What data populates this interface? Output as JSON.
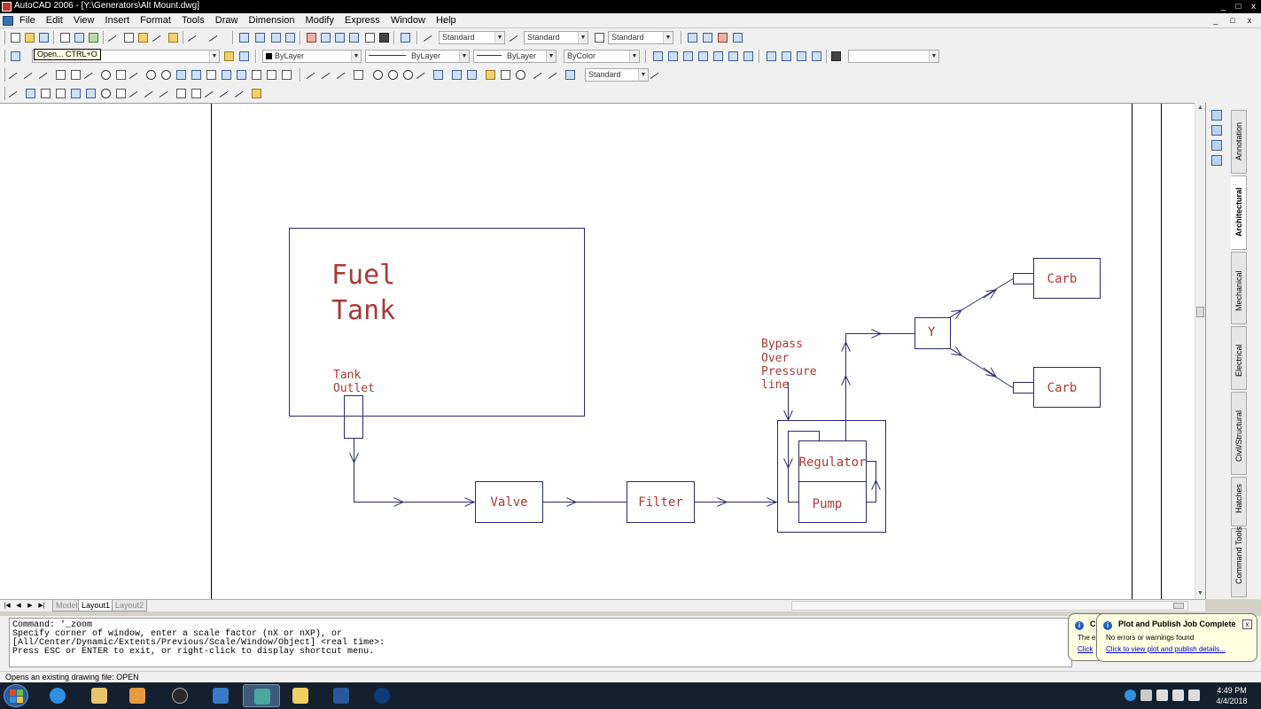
{
  "window": {
    "title": "AutoCAD 2006 - [Y:\\Generators\\Alt Mount.dwg]",
    "buttons": [
      "_",
      "□",
      "x"
    ]
  },
  "menu": {
    "items": [
      "File",
      "Edit",
      "View",
      "Insert",
      "Format",
      "Tools",
      "Draw",
      "Dimension",
      "Modify",
      "Express",
      "Window",
      "Help"
    ]
  },
  "toolbar": {
    "text_style": "Standard",
    "dim_style": "Standard",
    "table_style": "Standard",
    "layer": "",
    "color": "ByLayer",
    "linetype": "ByLayer",
    "lineweight": "ByLayer",
    "plot_style": "ByColor",
    "view_combo": "",
    "dim_style2": "Standard",
    "tooltip": "Open... CTRL+O"
  },
  "diagram": {
    "fuel_tank_line1": "Fuel",
    "fuel_tank_line2": "Tank",
    "tank_outlet_line1": "Tank",
    "tank_outlet_line2": "Outlet",
    "valve": "Valve",
    "filter": "Filter",
    "regulator": "Regulator",
    "pump": "Pump",
    "bypass": [
      "Bypass",
      "Over",
      "Pressure",
      "line"
    ],
    "y": "Y",
    "carb_top": "Carb",
    "carb_bottom": "Carb",
    "colors": {
      "text": "#a83a35",
      "line": "#2a2a6a"
    }
  },
  "palette": {
    "tabs": [
      "Annotation",
      "Architectural",
      "Mechanical",
      "Electrical",
      "Civil/Structural",
      "Hatches",
      "Command Tools"
    ],
    "active_tab": "Architectural"
  },
  "layout_tabs": [
    "Model",
    "Layout1",
    "Layout2"
  ],
  "command_lines": [
    "Command: '_zoom",
    "Specify corner of window, enter a scale factor (nX or nXP), or",
    "[All/Center/Dynamic/Extents/Previous/Scale/Window/Object] <real time>:",
    "Press ESC or ENTER to exit, or right-click to display shortcut menu."
  ],
  "status": "Opens an existing drawing file:  OPEN",
  "balloon_back": {
    "title": "C",
    "msg": "The e",
    "link": "Click"
  },
  "balloon": {
    "title": "Plot and Publish Job Complete",
    "message": "No errors or warnings found",
    "link": "Click to view plot and publish details..."
  },
  "clock": {
    "time": "4:49 PM",
    "date": "4/4/2018"
  }
}
